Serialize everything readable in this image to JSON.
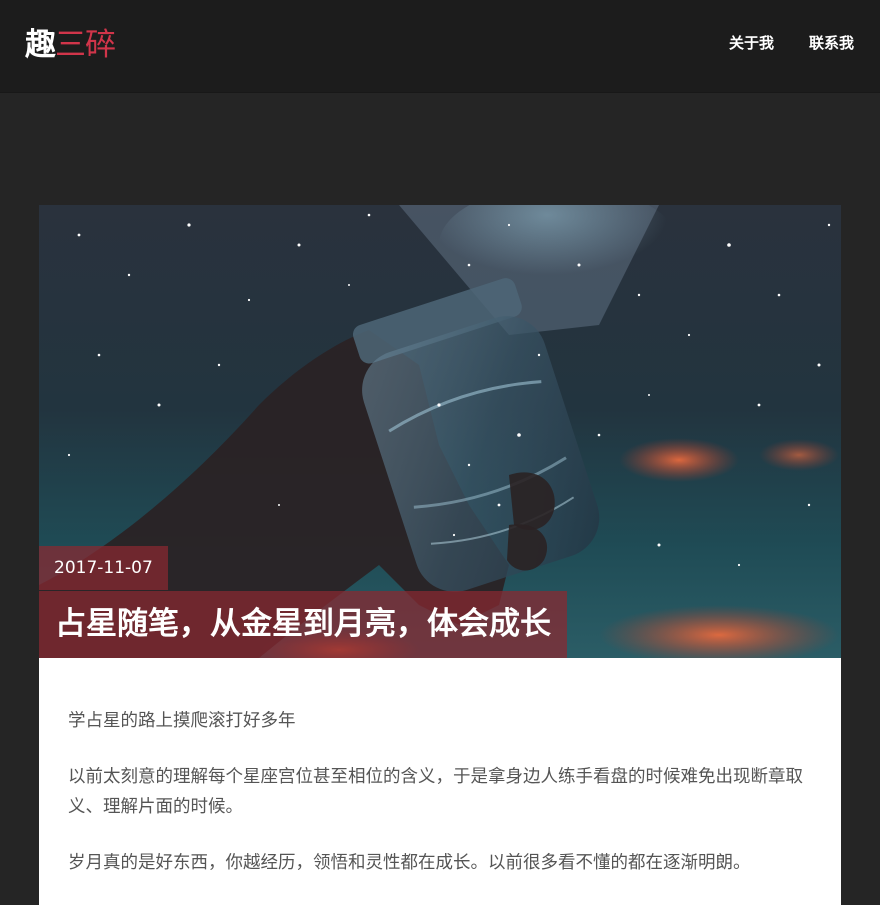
{
  "header": {
    "logo_main": "趣",
    "logo_sub": "三碎",
    "nav": [
      {
        "label": "关于我"
      },
      {
        "label": "联系我"
      }
    ]
  },
  "post": {
    "date": "2017-11-07",
    "title": "占星随笔，从金星到月亮，体会成长",
    "paragraphs": [
      "学占星的路上摸爬滚打好多年",
      "以前太刻意的理解每个星座宫位甚至相位的含义，于是拿身边人练手看盘的时候难免出现断章取义、理解片面的时候。",
      "岁月真的是好东西，你越经历，领悟和灵性都在成长。以前很多看不懂的都在逐渐明朗。"
    ]
  },
  "colors": {
    "header_bg": "#1c1c1c",
    "page_bg": "#252525",
    "accent": "#d1354a",
    "overlay": "#8a2830"
  }
}
